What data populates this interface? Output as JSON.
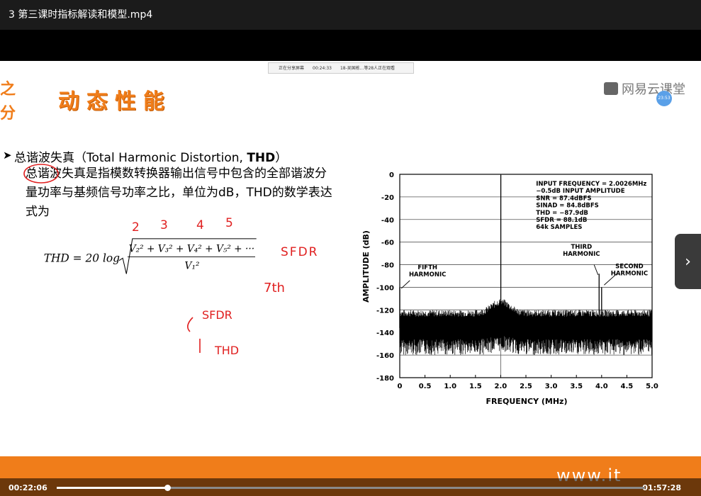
{
  "window": {
    "title": "3 第三课时指标解读和模型.mp4"
  },
  "share_bar": {
    "status": "正在分享屏幕",
    "time": "00:24:33",
    "viewers": "18-吴国栋...等28人正在观看"
  },
  "brand_left": {
    "line1": "之",
    "line2": "分"
  },
  "slide": {
    "heading": "动态性能",
    "bullet_title_cn": "总谐波失真（Total Harmonic Distortion, ",
    "bullet_title_abbr": "THD",
    "bullet_title_end": "）",
    "paragraph": "总谐波失真是指模数转换器输出信号中包含的全部谐波分量功率与基频信号功率之比，单位为dB，THD的数学表达式为",
    "formula": {
      "lhs": "THD = 20 log",
      "numerator": "V₂² + V₃² + V₄² + V₅² + ···",
      "denominator": "V₁²"
    },
    "logo": "网易云课堂",
    "avatar_text": "23:53",
    "watermark": "www.it"
  },
  "handwriting": {
    "n2": "2",
    "n3": "3",
    "n4": "4",
    "n5": "5",
    "sfdr1": "SFDR",
    "seventh": "7th",
    "sfdr2": "SFDR",
    "thd": "THD"
  },
  "chart_data": {
    "type": "line",
    "xlabel": "FREQUENCY (MHz)",
    "ylabel": "AMPLITUDE (dB)",
    "xlim": [
      0,
      5.0
    ],
    "ylim": [
      -180,
      0
    ],
    "x_ticks": [
      "0",
      "0.5",
      "1.0",
      "1.5",
      "2.0",
      "2.5",
      "3.0",
      "3.5",
      "4.0",
      "4.5",
      "5.0"
    ],
    "y_ticks": [
      "0",
      "-20",
      "-40",
      "-60",
      "-80",
      "-100",
      "-120",
      "-140",
      "-160",
      "-180"
    ],
    "grid": true,
    "info": [
      "INPUT FREQUENCY = 2.0026MHz",
      "−0.5dB INPUT AMPLITUDE",
      "SNR = 87.4dBFS",
      "SINAD = 84.8dBFS",
      "THD = −87.9dB",
      "SFDR = 88.1dB",
      "64k SAMPLES"
    ],
    "annotations": [
      {
        "label": [
          "FIFTH",
          "HARMONIC"
        ],
        "x": 0.0,
        "y": -100
      },
      {
        "label": [
          "THIRD",
          "HARMONIC"
        ],
        "x": 3.95,
        "y": -88
      },
      {
        "label": [
          "SECOND",
          "HARMONIC"
        ],
        "x": 4.0,
        "y": -100
      }
    ],
    "series": [
      {
        "points": [
          [
            0.0,
            -100
          ],
          [
            2.0026,
            -0.5
          ],
          [
            3.95,
            -88
          ],
          [
            4.0,
            -100
          ]
        ],
        "noise_floor": -136
      }
    ]
  },
  "player": {
    "current_time": "00:22:06",
    "total_time": "01:57:28",
    "progress": 0.188
  }
}
